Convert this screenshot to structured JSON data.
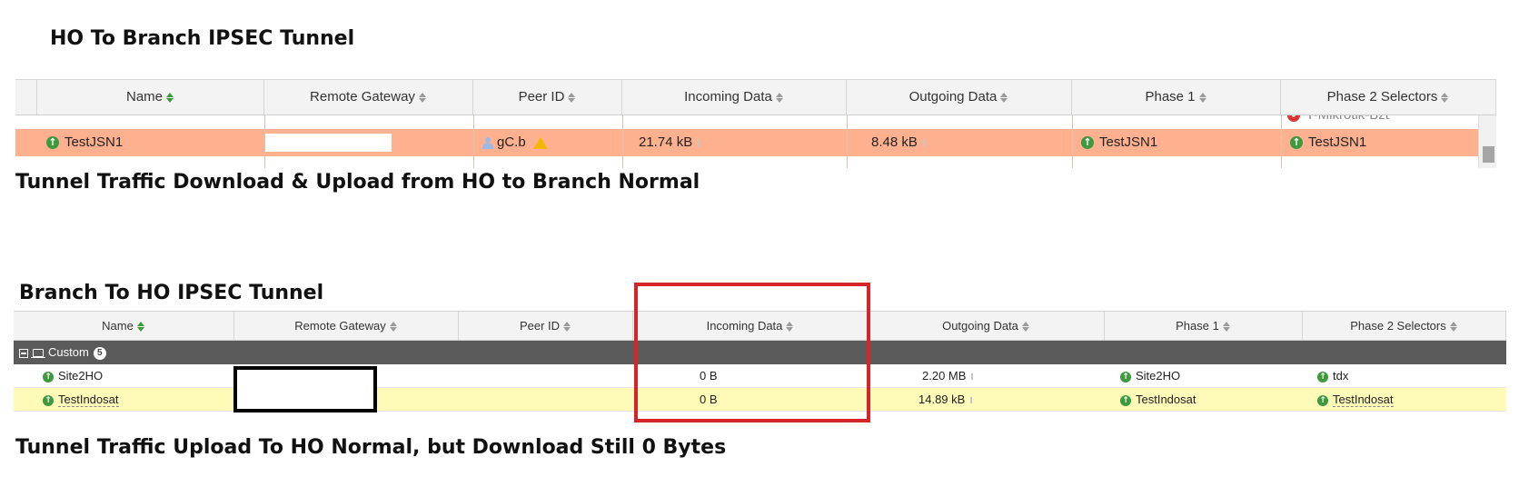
{
  "headings": {
    "top_title": "HO To Branch IPSEC Tunnel",
    "top_caption": "Tunnel Traffic Download & Upload from HO to Branch Normal",
    "bottom_title": "Branch To HO IPSEC Tunnel",
    "bottom_caption": "Tunnel Traffic Upload To HO Normal, but Download Still 0 Bytes"
  },
  "columns": [
    "Name",
    "Remote Gateway",
    "Peer ID",
    "Incoming Data",
    "Outgoing Data",
    "Phase 1",
    "Phase 2 Selectors"
  ],
  "table1": {
    "partial_row_selector": "Y-Mikrotik-Bzt",
    "rows": [
      {
        "name": "TestJSN1",
        "remote_gateway": "",
        "peer_id": "gC.b",
        "incoming": "21.74 kB",
        "outgoing": "8.48 kB",
        "phase1": "TestJSN1",
        "phase2": "TestJSN1",
        "highlighted": true
      }
    ]
  },
  "table2": {
    "group": {
      "label": "Custom",
      "count": "5"
    },
    "rows": [
      {
        "name": "Site2HO",
        "remote_gateway": "",
        "peer_id": "",
        "incoming": "0 B",
        "outgoing": "2.20 MB",
        "phase1": "Site2HO",
        "phase2": "tdx",
        "highlighted": false
      },
      {
        "name": "TestIndosat",
        "remote_gateway": "",
        "peer_id": "",
        "incoming": "0 B",
        "outgoing": "14.89 kB",
        "phase1": "TestIndosat",
        "phase2": "TestIndosat",
        "highlighted": true
      }
    ]
  },
  "colors": {
    "row_highlight_orange": "#ffb08e",
    "row_highlight_yellow": "#fefab8",
    "group_header": "#5a5a5a",
    "status_up_green": "#3f9a3f",
    "status_down_red": "#dd3333",
    "annotation_red": "#d6242b"
  },
  "icons": {
    "status_up": "arrow-up-circle-icon",
    "status_down": "arrow-down-circle-icon",
    "peer": "user-icon",
    "warning": "warning-triangle-icon",
    "sort": "sort-arrows-icon",
    "collapse": "collapse-minus-icon",
    "group": "laptop-icon"
  }
}
